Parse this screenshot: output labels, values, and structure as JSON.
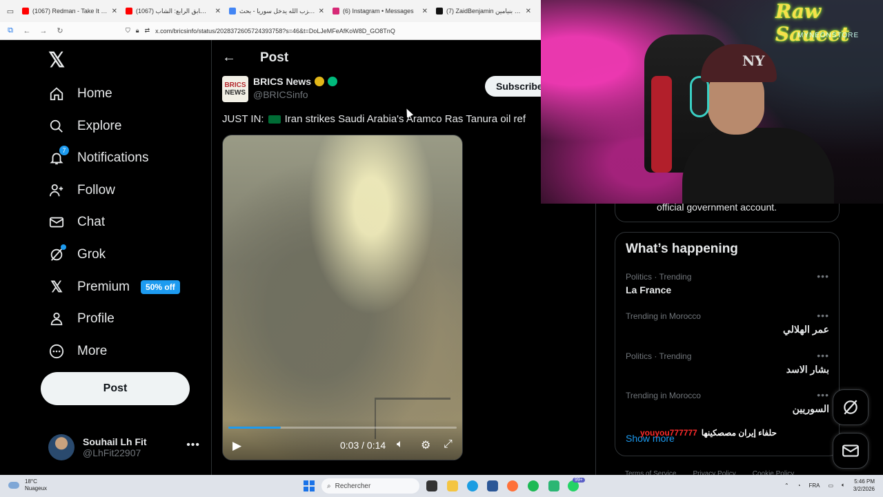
{
  "browser": {
    "tabs": [
      {
        "title": "(1067) Redman - Take It Person",
        "color": "#ff0000"
      },
      {
        "title": "(1067) لغز الطابق الرابع: الشاب",
        "color": "#ff0000"
      },
      {
        "title": "حزب الله يدخل سوريا - بحث Google",
        "color": "#4285f4"
      },
      {
        "title": "(6) Instagram • Messages",
        "color": "#d62976"
      },
      {
        "title": "(7) ZaidBenjamin زيد بنيامين on",
        "color": "#111111"
      }
    ],
    "url": "x.com/bricsinfo/status/2028372605724393758?s=46&t=DoLJeMFeAfKoW8D_GO8TnQ"
  },
  "nav": {
    "items": [
      {
        "label": "Home",
        "icon": "home-icon"
      },
      {
        "label": "Explore",
        "icon": "search-icon"
      },
      {
        "label": "Notifications",
        "icon": "bell-icon",
        "badge": "7"
      },
      {
        "label": "Follow",
        "icon": "add-person-icon"
      },
      {
        "label": "Chat",
        "icon": "envelope-icon"
      },
      {
        "label": "Grok",
        "icon": "grok-icon"
      },
      {
        "label": "Premium",
        "icon": "x-logo-icon",
        "pill": "50% off"
      },
      {
        "label": "Profile",
        "icon": "person-icon"
      },
      {
        "label": "More",
        "icon": "more-circle-icon"
      }
    ],
    "post_button": "Post",
    "account": {
      "name": "Souhail Lh Fit",
      "handle": "@LhFit22907"
    }
  },
  "post": {
    "header_title": "Post",
    "author_name": "BRICS News",
    "author_handle": "@BRICSinfo",
    "logo_line1": "BRICS",
    "logo_line2": "NEWS",
    "subscribe_label": "Subscribe",
    "text_prefix": "JUST IN:",
    "text_body": "Iran strikes Saudi Arabia's Aramco Ras Tanura oil ref",
    "video": {
      "time": "0:03 / 0:14",
      "progress": 0.23
    }
  },
  "sidebar": {
    "card_text": "official government account.",
    "trends_title": "What’s happening",
    "trends": [
      {
        "meta": "Politics · Trending",
        "topic": "La France",
        "rtl": false
      },
      {
        "meta": "Trending in Morocco",
        "topic": "عمر الهلالي",
        "rtl": true
      },
      {
        "meta": "Politics · Trending",
        "topic": "بشار الاسد",
        "rtl": true
      },
      {
        "meta": "Trending in Morocco",
        "topic": "السوريين",
        "rtl": true
      }
    ],
    "show_more": "Show more",
    "footer_links": [
      "Terms of Service",
      "Privacy Policy",
      "Cookie Policy"
    ]
  },
  "stream": {
    "neon_title": "Raw Saueet",
    "neon_sub": "MYNEONSTORE",
    "cap_logo": "NY",
    "chat_user": "youyou777777",
    "chat_message": "حلفاء إيران مصصكينها"
  },
  "taskbar": {
    "weather_temp": "18°C",
    "weather_desc": "Nuageux",
    "search_placeholder": "Rechercher",
    "badge": "99+",
    "lang": "FRA",
    "time": "5:46 PM",
    "date": "3/2/2026"
  }
}
